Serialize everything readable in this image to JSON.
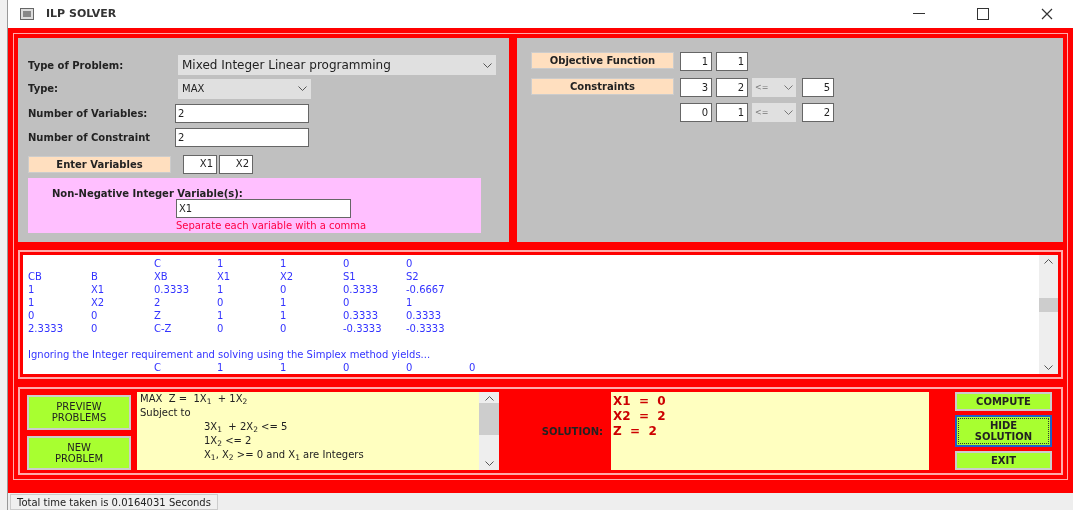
{
  "window": {
    "title": "ILP SOLVER"
  },
  "problem": {
    "type_of_problem": {
      "label": "Type of Problem:",
      "value": "Mixed Integer Linear programming"
    },
    "type": {
      "label": "Type:",
      "value": "MAX"
    },
    "num_variables": {
      "label": "Number of Variables:",
      "value": "2"
    },
    "num_constraints": {
      "label": "Number of Constraint",
      "value": "2"
    },
    "enter_variables": "Enter Variables",
    "variables": [
      "X1",
      "X2"
    ],
    "integer_vars": {
      "label": "Non-Negative Integer Variable(s):",
      "value": "X1",
      "hint": "Separate each variable with a comma"
    }
  },
  "objective": {
    "label": "Objective Function",
    "coefficients": [
      "1",
      "1"
    ]
  },
  "constraints": {
    "label": "Constraints",
    "rows": [
      {
        "coefficients": [
          "3",
          "2"
        ],
        "operator": "<=",
        "rhs": "5"
      },
      {
        "coefficients": [
          "0",
          "1"
        ],
        "operator": "<=",
        "rhs": "2"
      }
    ]
  },
  "output": {
    "lines": [
      {
        "kind": "row",
        "cells": [
          "",
          "",
          "C",
          "1",
          "1",
          "0",
          "0"
        ]
      },
      {
        "kind": "row",
        "cells": [
          "CB",
          "B",
          "XB",
          "X1",
          "X2",
          "S1",
          "S2"
        ]
      },
      {
        "kind": "row",
        "cells": [
          "1",
          "X1",
          "0.3333",
          "1",
          "0",
          "0.3333",
          "-0.6667"
        ]
      },
      {
        "kind": "row",
        "cells": [
          "1",
          "X2",
          "2",
          "0",
          "1",
          "0",
          "1"
        ]
      },
      {
        "kind": "row",
        "cells": [
          "0",
          "0",
          "Z",
          "1",
          "1",
          "0.3333",
          "0.3333"
        ]
      },
      {
        "kind": "row",
        "cells": [
          "2.3333",
          "0",
          "C-Z",
          "0",
          "0",
          "-0.3333",
          "-0.3333"
        ]
      },
      {
        "kind": "blank"
      },
      {
        "kind": "text",
        "text": "Ignoring the Integer requirement and solving using the Simplex method yields..."
      },
      {
        "kind": "row",
        "cells": [
          "",
          "",
          "C",
          "1",
          "1",
          "0",
          "0",
          "0"
        ]
      }
    ]
  },
  "left_buttons": [
    {
      "label": "PREVIEW PROBLEMS"
    },
    {
      "label": "NEW PROBLEM"
    }
  ],
  "problem_text": [
    "MAX  Z =  1X$_{1}$  + 1X$_{2}$",
    "Subject to",
    "3X$_{1}$  + 2X$_{2}$ <= 5",
    "1X$_{2}$ <= 2",
    "X$_{1}$, X$_{2}$ >= 0 and X$_{1}$ are Integers"
  ],
  "solution": {
    "label": "SOLUTION:",
    "lines": [
      "X1  =  0",
      "X2  =  2",
      "Z  =  2"
    ]
  },
  "right_buttons": [
    {
      "label": "COMPUTE",
      "focused": false
    },
    {
      "label": "HIDE SOLUTION",
      "focused": true
    },
    {
      "label": "EXIT",
      "focused": false
    }
  ],
  "status_bar": "Total time taken is 0.0164031 Seconds"
}
